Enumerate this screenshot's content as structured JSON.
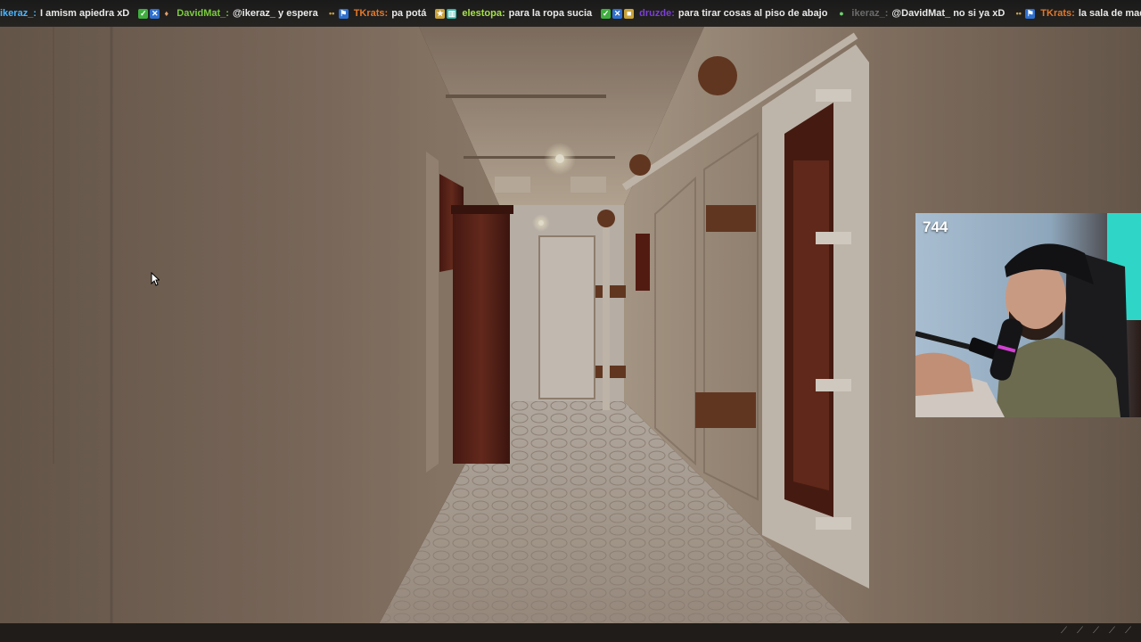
{
  "chat_ticker": [
    {
      "user": "ikeraz_:",
      "message": "I amism apiedra xD",
      "user_color": "#49b6ff",
      "badges": []
    },
    {
      "user": "DavidMat_:",
      "message": "@ikeraz_ y espera",
      "user_color": "#7ccb3f",
      "badges": [
        "green-check-badge",
        "blue-badge",
        "drop-badge"
      ]
    },
    {
      "user": "TKrats:",
      "message": "pa potá",
      "user_color": "#e0782c",
      "badges": [
        "dots-badge",
        "flag-badge"
      ]
    },
    {
      "user": "elestopa:",
      "message": "para la ropa sucia",
      "user_color": "#a6e04a",
      "badges": [
        "gift-badge",
        "teal-badge"
      ]
    },
    {
      "user": "druzde:",
      "message": "para tirar cosas al piso de abajo",
      "user_color": "#7b3fd6",
      "badges": [
        "green-check-badge",
        "blue-badge",
        "gift-badge"
      ]
    },
    {
      "user": "ikeraz_:",
      "message": "@DavidMat_ no si ya xD",
      "user_color": "#6b6b6b",
      "badges": [
        "ball-badge"
      ]
    },
    {
      "user": "TKrats:",
      "message": "la sala de maquinas",
      "user_color": "#e0782c",
      "badges": [
        "dots-badge",
        "flag-badge"
      ]
    }
  ],
  "webcam": {
    "viewer_count": "744"
  },
  "colors": {
    "wall": "#7c6a5b",
    "floor": "#b7aa9f",
    "door_wood": "#5a1e16",
    "ticker_bg": "#1e1c1a"
  }
}
